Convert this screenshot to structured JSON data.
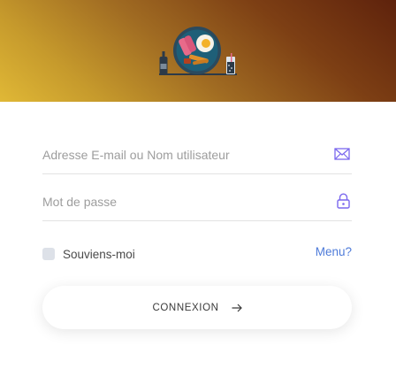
{
  "login": {
    "email_placeholder": "Adresse E-mail ou Nom utilisateur",
    "password_placeholder": "Mot de passe",
    "remember_label": "Souviens-moi",
    "menu_link": "Menu?",
    "submit_label": "CONNEXION"
  },
  "icons": {
    "email": "envelope-icon",
    "password": "lock-icon",
    "submit": "arrow-right-icon"
  },
  "colors": {
    "header_gradient_start": "#e0b836",
    "header_gradient_end": "#5e220c",
    "icon_accent": "#7b68ee",
    "link": "#4e7bd9",
    "plate": "#1e5f78"
  }
}
